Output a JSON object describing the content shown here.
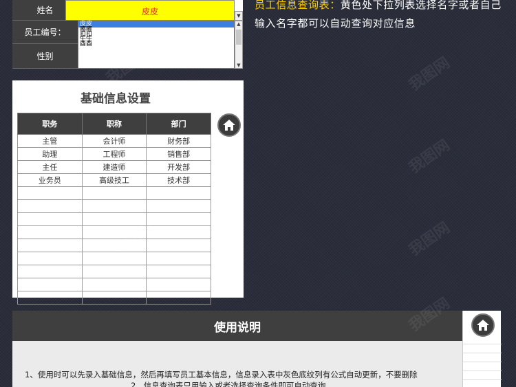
{
  "employee_form": {
    "name_label": "姓名",
    "id_label": "员工编号：",
    "gender_label": "性别",
    "selected_name": "皮皮",
    "dropdown_options": [
      "皮皮",
      "嘟嘟",
      "扣扣",
      "牛牛",
      "酉酉"
    ]
  },
  "info": {
    "highlight": "员工信息查询表：",
    "text": "黄色处下拉列表选择名字或者自己输入名字都可以自动查询对应信息"
  },
  "basic_info": {
    "title": "基础信息设置",
    "columns": [
      "职务",
      "职称",
      "部门"
    ],
    "rows": [
      [
        "主管",
        "会计师",
        "财务部"
      ],
      [
        "助理",
        "工程师",
        "销售部"
      ],
      [
        "主任",
        "建造师",
        "开发部"
      ],
      [
        "业务员",
        "高级技工",
        "技术部"
      ]
    ]
  },
  "usage": {
    "title": "使用说明",
    "line1": "1、使用时可以先录入基础信息，然后再填写员工基本信息，信息录入表中灰色底纹列有公式自动更新，不要删除",
    "line2": "2、信息查询表只用输入或者选择查询条件即可自动查询"
  },
  "colors": {
    "background": "#2a2d3a",
    "header_dark": "#3f3f3f",
    "select_yellow": "#ffff00",
    "selected_text": "#e03030",
    "highlight": "#ffd200"
  }
}
